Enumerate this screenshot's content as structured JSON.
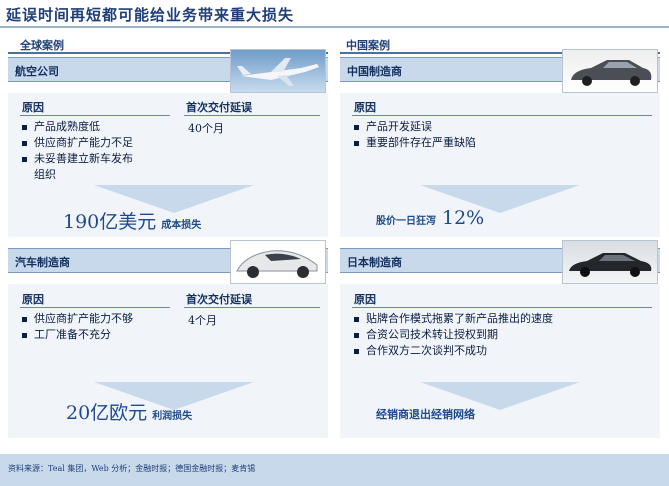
{
  "title": "延误时间再短都可能给业务带来重大损失",
  "sections": {
    "global": "全球案例",
    "china": "中国案例"
  },
  "panels": {
    "airline": {
      "header": "航空公司",
      "photo": "airplane-photo",
      "reason_label": "原因",
      "delay_label": "首次交付延误",
      "reasons": [
        "产品成熟度低",
        "供应商扩产能力不足",
        "未妥善建立新车发布组织"
      ],
      "delay": "40个月",
      "loss_value": "190亿美元",
      "loss_label": "成本损失"
    },
    "automaker": {
      "header": "汽车制造商",
      "photo": "concept-car-photo",
      "reason_label": "原因",
      "delay_label": "首次交付延误",
      "reasons": [
        "供应商扩产能力不够",
        "工厂准备不充分"
      ],
      "delay": "4个月",
      "loss_value": "20亿欧元",
      "loss_label": "利润损失"
    },
    "china_maker": {
      "header": "中国制造商",
      "photo": "sedan-photo",
      "reason_label": "原因",
      "reasons": [
        "产品开发延误",
        "重要部件存在严重缺陷"
      ],
      "loss_prefix": "股价一日狂泻",
      "loss_value": "12%"
    },
    "japan_maker": {
      "header": "日本制造商",
      "photo": "dark-sedan-photo",
      "reason_label": "原因",
      "reasons": [
        "贴牌合作模式拖累了新产品推出的速度",
        "合资公司技术转让授权到期",
        "合作双方二次谈判不成功"
      ],
      "loss_label": "经销商退出经销网络"
    }
  },
  "footer": "资料来源：Teal 集团，Web 分析；金融时报；德国金融时报；麦肯锡"
}
